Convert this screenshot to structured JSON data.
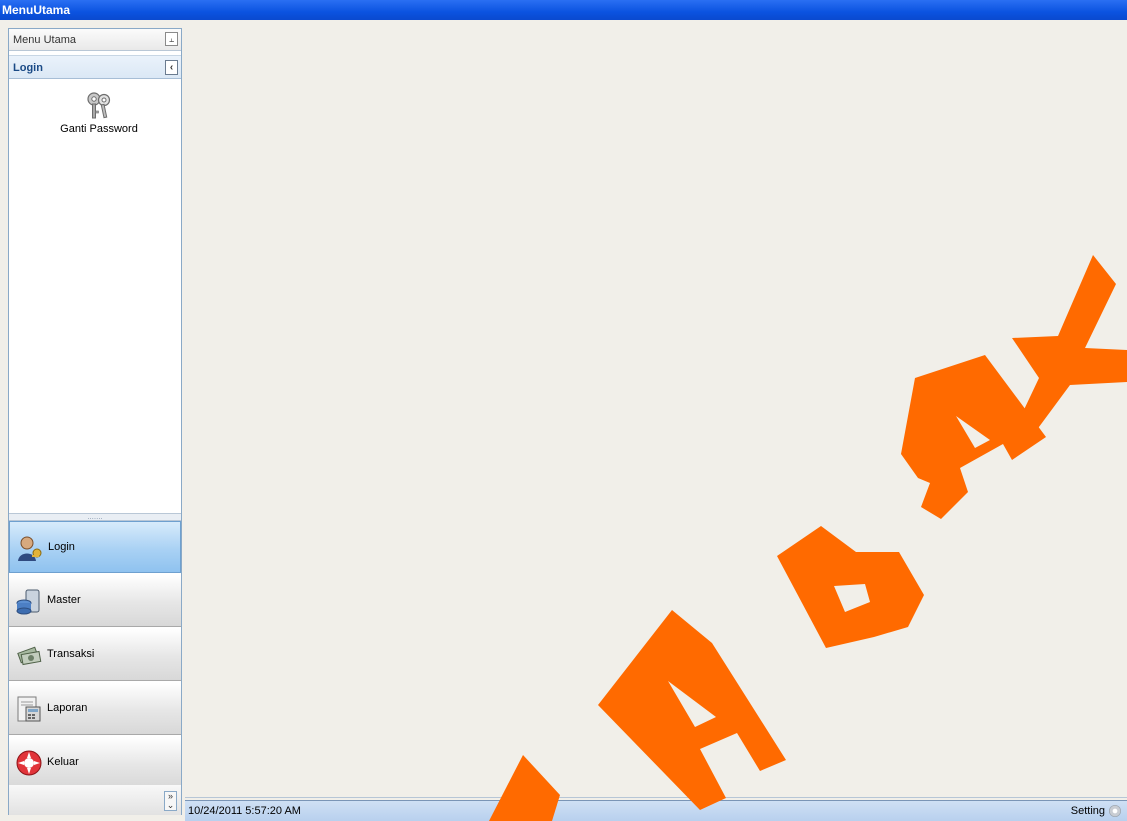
{
  "window": {
    "title": "MenuUtama"
  },
  "nav": {
    "header_label": "Menu Utama",
    "pin_icon": "pin-icon",
    "section_title": "Login",
    "collapse_icon": "chevron-left-icon",
    "items": [
      {
        "label": "Ganti Password",
        "icon": "keys-icon"
      }
    ],
    "buttons": [
      {
        "label": "Login",
        "icon": "user-key-icon",
        "active": true
      },
      {
        "label": "Master",
        "icon": "database-icon",
        "active": false
      },
      {
        "label": "Transaksi",
        "icon": "cash-icon",
        "active": false
      },
      {
        "label": "Laporan",
        "icon": "report-icon",
        "active": false
      },
      {
        "label": "Keluar",
        "icon": "exit-icon",
        "active": false
      }
    ],
    "more_icon": "chevron-double-right-icon"
  },
  "status": {
    "timestamp": "10/24/2011 5:57:20 AM",
    "setting_label": "Setting",
    "setting_icon": "gear-icon"
  },
  "watermark": {
    "color": "#ff6a00"
  },
  "colors": {
    "titlebar": "#0b53e0",
    "active_nav": "#a9d1f4",
    "statusbar": "#c3d8f2"
  }
}
